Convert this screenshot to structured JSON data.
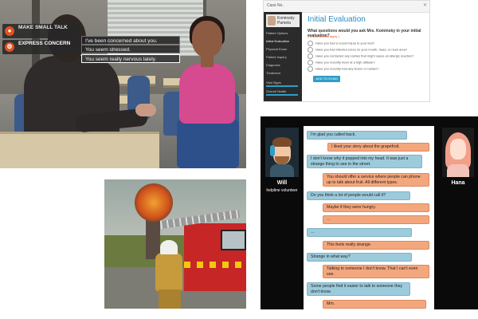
{
  "classroom": {
    "menu": [
      {
        "icon": "chat-bubble-icon",
        "label": "MAKE SMALL TALK"
      },
      {
        "icon": "gear-icon",
        "label": "EXPRESS CONCERN"
      }
    ],
    "responses": [
      "I've been concerned about you.",
      "You seem stressed.",
      "You seem really nervous lately."
    ]
  },
  "evaluation": {
    "case_label": "Case No.",
    "patient_name": "Kominsky Pamela",
    "sidebar": [
      "Patient Options",
      "Initial Evaluation",
      "Physical Exam",
      "Patient Inquiry",
      "Diagnosis",
      "Treatment",
      "Vital Signs",
      "Overall Health"
    ],
    "title": "Initial Evaluation",
    "question": "What questions would you ask Mrs. Kominsky in your initial evaluation?",
    "hint": "( Check all that apply )",
    "options": [
      "Have you had a recent injury to your feet?",
      "Have you had infected sores on your mouth, head, or neck area?",
      "Have you contacted any rashes that might cause an allergic reaction?",
      "Have you recently been at a high altitude?",
      "Have you recently had any fevers or rashes?"
    ],
    "button": "ADD TO EXAM"
  },
  "chat": {
    "left_name": "Will",
    "left_role": "helpline volunteer",
    "right_name": "Hana",
    "messages": [
      {
        "side": "b",
        "text": "I'm glad you called back."
      },
      {
        "side": "o",
        "text": "I liked your story about the grapefruit."
      },
      {
        "side": "b",
        "text": "I don't know why it popped into my head. It was just a strange thing to see in the street."
      },
      {
        "side": "o",
        "text": "You should offer a service where people can phone up to talk about fruit. All different types."
      },
      {
        "side": "b",
        "text": "Do you think a lot of people would call it?"
      },
      {
        "side": "o",
        "text": "Maybe if they were hungry."
      },
      {
        "side": "o",
        "text": "..."
      },
      {
        "side": "b",
        "text": "..."
      },
      {
        "side": "o",
        "text": "This feels really strange."
      },
      {
        "side": "b",
        "text": "Strange in what way?"
      },
      {
        "side": "o",
        "text": "Talking to someone I don't know. That I can't even see."
      },
      {
        "side": "b",
        "text": "Some people find it easier to talk to someone they don't know."
      },
      {
        "side": "o",
        "text": "Mm."
      }
    ]
  }
}
